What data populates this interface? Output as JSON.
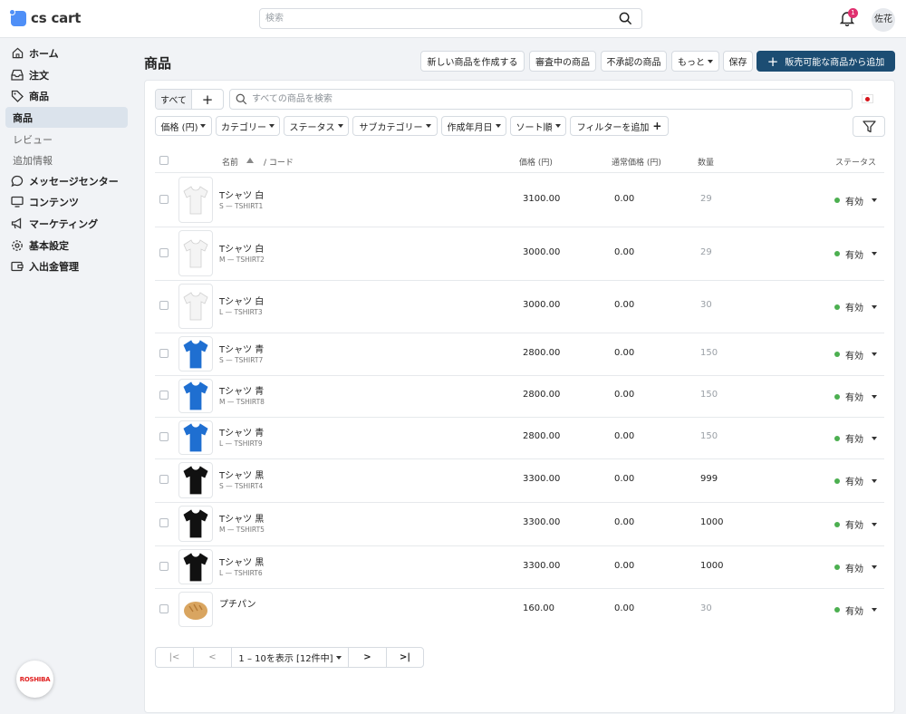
{
  "app": {
    "brand": "cs cart"
  },
  "topbar": {
    "search_placeholder": "検索",
    "notification_count": "1",
    "user": "佐花"
  },
  "sidebar": {
    "items": [
      {
        "label": "ホーム",
        "icon": "home-icon"
      },
      {
        "label": "注文",
        "icon": "inbox-icon"
      },
      {
        "label": "商品",
        "icon": "tag-icon"
      }
    ],
    "active": "商品",
    "sub": [
      "レビュー",
      "追加情報"
    ],
    "items2": [
      {
        "label": "メッセージセンター",
        "icon": "chat-icon"
      },
      {
        "label": "コンテンツ",
        "icon": "monitor-icon"
      },
      {
        "label": "マーケティング",
        "icon": "megaphone-icon"
      },
      {
        "label": "基本設定",
        "icon": "gear-icon"
      },
      {
        "label": "入出金管理",
        "icon": "wallet-icon"
      }
    ],
    "brand_badge": "ROSHIBA"
  },
  "header": {
    "title": "商品",
    "btn_create": "新しい商品を作成する",
    "btn_review": "審査中の商品",
    "btn_unapproved": "不承認の商品",
    "btn_more": "もっと",
    "btn_save": "保存",
    "btn_add_sellable": "販売可能な商品から追加"
  },
  "filters": {
    "tab_all": "すべて",
    "search_placeholder": "すべての商品を検索",
    "chips": [
      "価格 (円)",
      "カテゴリー",
      "ステータス",
      "サブカテゴリー",
      "作成年月日",
      "ソート順"
    ],
    "add_filter": "フィルターを追加"
  },
  "table": {
    "headers": {
      "name": "名前",
      "code": "/ コード",
      "price": "価格 (円)",
      "list_price": "通常価格 (円)",
      "qty": "数量",
      "status": "ステータス"
    },
    "rows": [
      {
        "name": "Tシャツ 白",
        "code": "S — TSHIRT1",
        "price": "3100.00",
        "list_price": "0.00",
        "qty": "29",
        "status": "有効",
        "color": "#f4f4f4",
        "img": "shirt"
      },
      {
        "name": "Tシャツ 白",
        "code": "M — TSHIRT2",
        "price": "3000.00",
        "list_price": "0.00",
        "qty": "29",
        "status": "有効",
        "color": "#f4f4f4",
        "img": "shirt"
      },
      {
        "name": "Tシャツ 白",
        "code": "L — TSHIRT3",
        "price": "3000.00",
        "list_price": "0.00",
        "qty": "30",
        "status": "有効",
        "color": "#f4f4f4",
        "img": "shirt"
      },
      {
        "name": "Tシャツ 青",
        "code": "S — TSHIRT7",
        "price": "2800.00",
        "list_price": "0.00",
        "qty": "150",
        "status": "有効",
        "color": "#1f6fd1",
        "img": "shirt"
      },
      {
        "name": "Tシャツ 青",
        "code": "M — TSHIRT8",
        "price": "2800.00",
        "list_price": "0.00",
        "qty": "150",
        "status": "有効",
        "color": "#1f6fd1",
        "img": "shirt"
      },
      {
        "name": "Tシャツ 青",
        "code": "L — TSHIRT9",
        "price": "2800.00",
        "list_price": "0.00",
        "qty": "150",
        "status": "有効",
        "color": "#1f6fd1",
        "img": "shirt"
      },
      {
        "name": "Tシャツ 黒",
        "code": "S — TSHIRT4",
        "price": "3300.00",
        "list_price": "0.00",
        "qty": "999",
        "status": "有効",
        "color": "#111111",
        "img": "shirt"
      },
      {
        "name": "Tシャツ 黒",
        "code": "M — TSHIRT5",
        "price": "3300.00",
        "list_price": "0.00",
        "qty": "1000",
        "status": "有効",
        "color": "#111111",
        "img": "shirt"
      },
      {
        "name": "Tシャツ 黒",
        "code": "L — TSHIRT6",
        "price": "3300.00",
        "list_price": "0.00",
        "qty": "1000",
        "status": "有効",
        "color": "#111111",
        "img": "shirt"
      },
      {
        "name": "プチパン",
        "code": "",
        "price": "160.00",
        "list_price": "0.00",
        "qty": "30",
        "status": "有効",
        "color": "#d9a560",
        "img": "bread"
      }
    ]
  },
  "pagination": {
    "summary": "1 – 10を表示 [12件中]"
  },
  "colors": {
    "accent": "#1c4d73",
    "status_active": "#4caf50",
    "badge": "#e0306f"
  }
}
